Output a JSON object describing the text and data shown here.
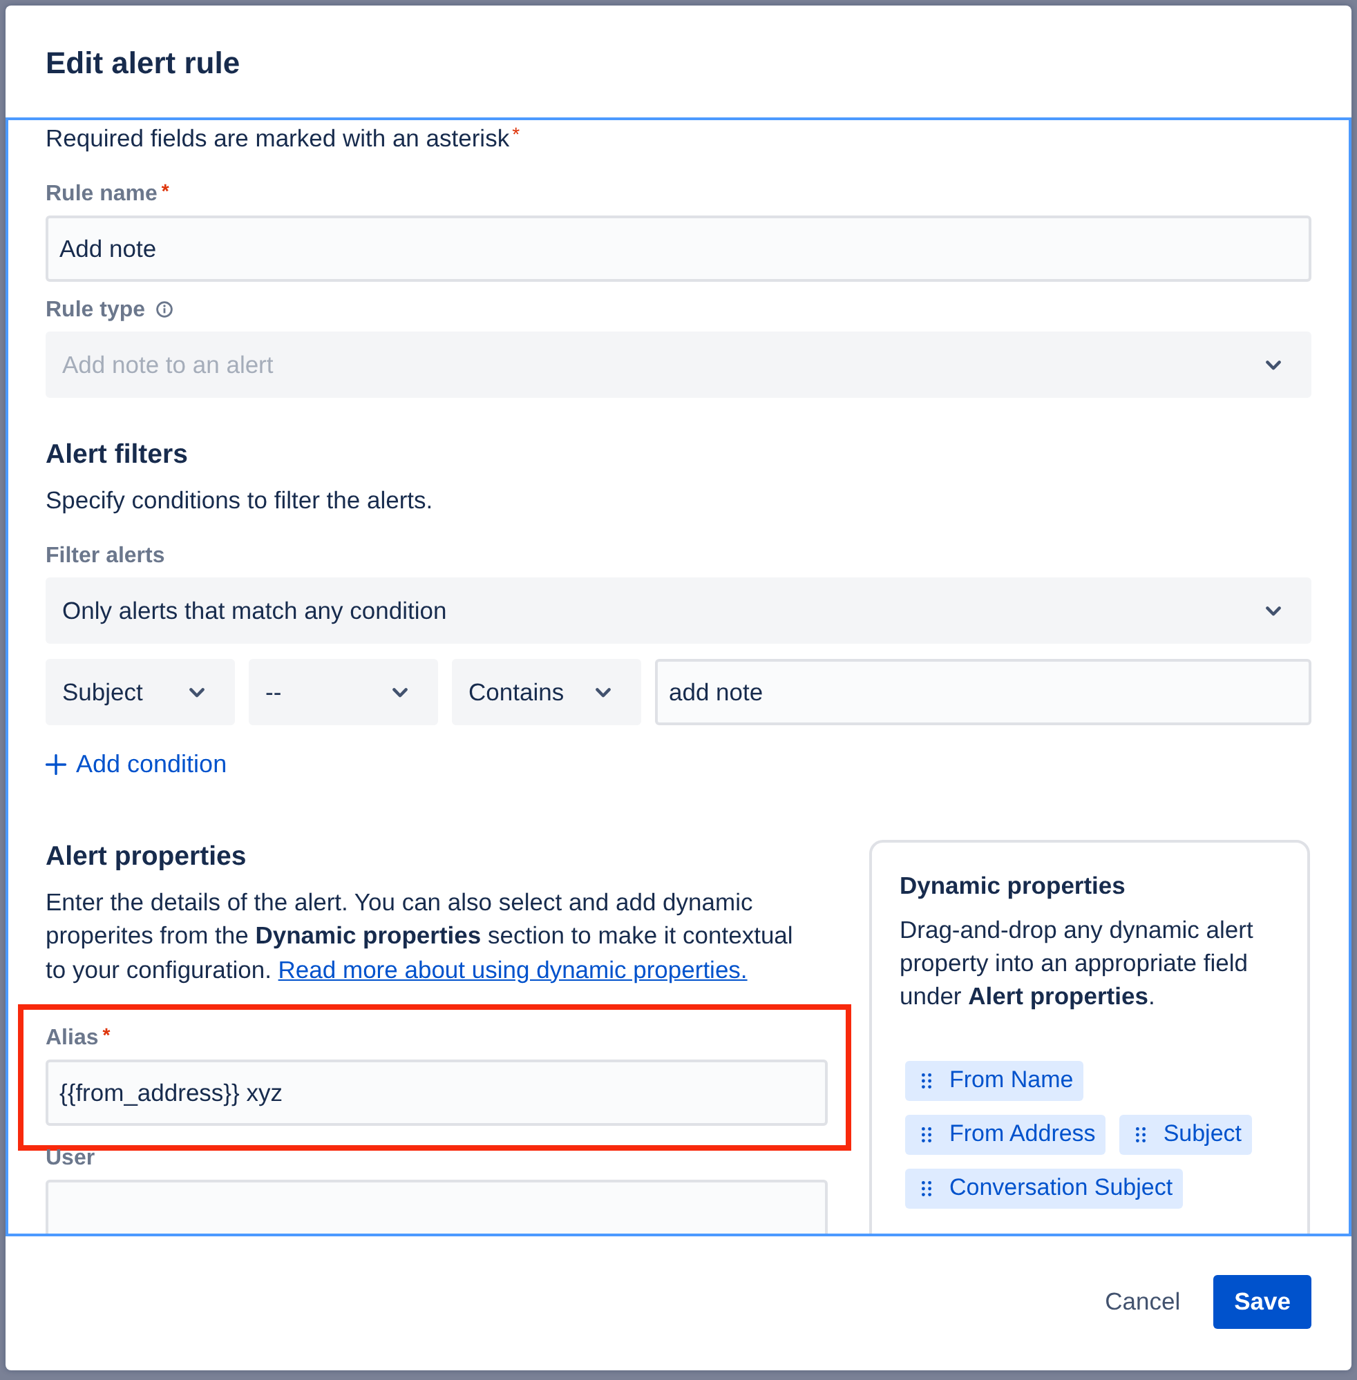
{
  "dialog": {
    "title": "Edit alert rule"
  },
  "required_note": {
    "text": "Required fields are marked with an asterisk",
    "asterisk": "*"
  },
  "rule_fields": [
    {
      "kind": "input",
      "label": "Rule name",
      "asterisk": "*",
      "value": "Add note",
      "disabled": false
    },
    {
      "kind": "select",
      "label": "Rule type",
      "info_icon": true,
      "value": "Add note to an alert",
      "disabled": true
    }
  ],
  "alert_filters": {
    "heading": "Alert filters",
    "description": "Specify conditions to filter the alerts.",
    "filter_label": "Filter alerts",
    "match": "Only alerts that match any condition",
    "condition": [
      {
        "kind": "select",
        "value": "Subject"
      },
      {
        "kind": "select",
        "value": "--"
      },
      {
        "kind": "select",
        "value": "Contains"
      },
      {
        "kind": "input",
        "value": "add note"
      }
    ],
    "add_condition": "Add condition"
  },
  "alert_properties": {
    "heading": "Alert properties",
    "description": "Enter the details of the alert. You can also select and add dynamic properites from the **Dynamic properties** section to make it contextual to your configuration.",
    "link": "Read more about using dynamic properties.",
    "fields": [
      {
        "kind": "input",
        "label": "Alias",
        "asterisk": "*",
        "value": "{{from_address}} xyz",
        "highlighted": true
      },
      {
        "kind": "input",
        "label": "User",
        "highlighted": false
      }
    ]
  },
  "dynamic_properties": {
    "heading": "Dynamic properties",
    "description": "Drag-and-drop any dynamic alert property into an appropriate field under **Alert properties**.",
    "chips": [
      {
        "label": "From Name"
      },
      {
        "label": "From Address"
      },
      {
        "label": "Subject"
      },
      {
        "label": "Conversation Subject"
      }
    ]
  },
  "footer": {
    "buttons": [
      {
        "kind": "subtle",
        "label": "Cancel"
      },
      {
        "kind": "primary",
        "label": "Save"
      }
    ]
  }
}
